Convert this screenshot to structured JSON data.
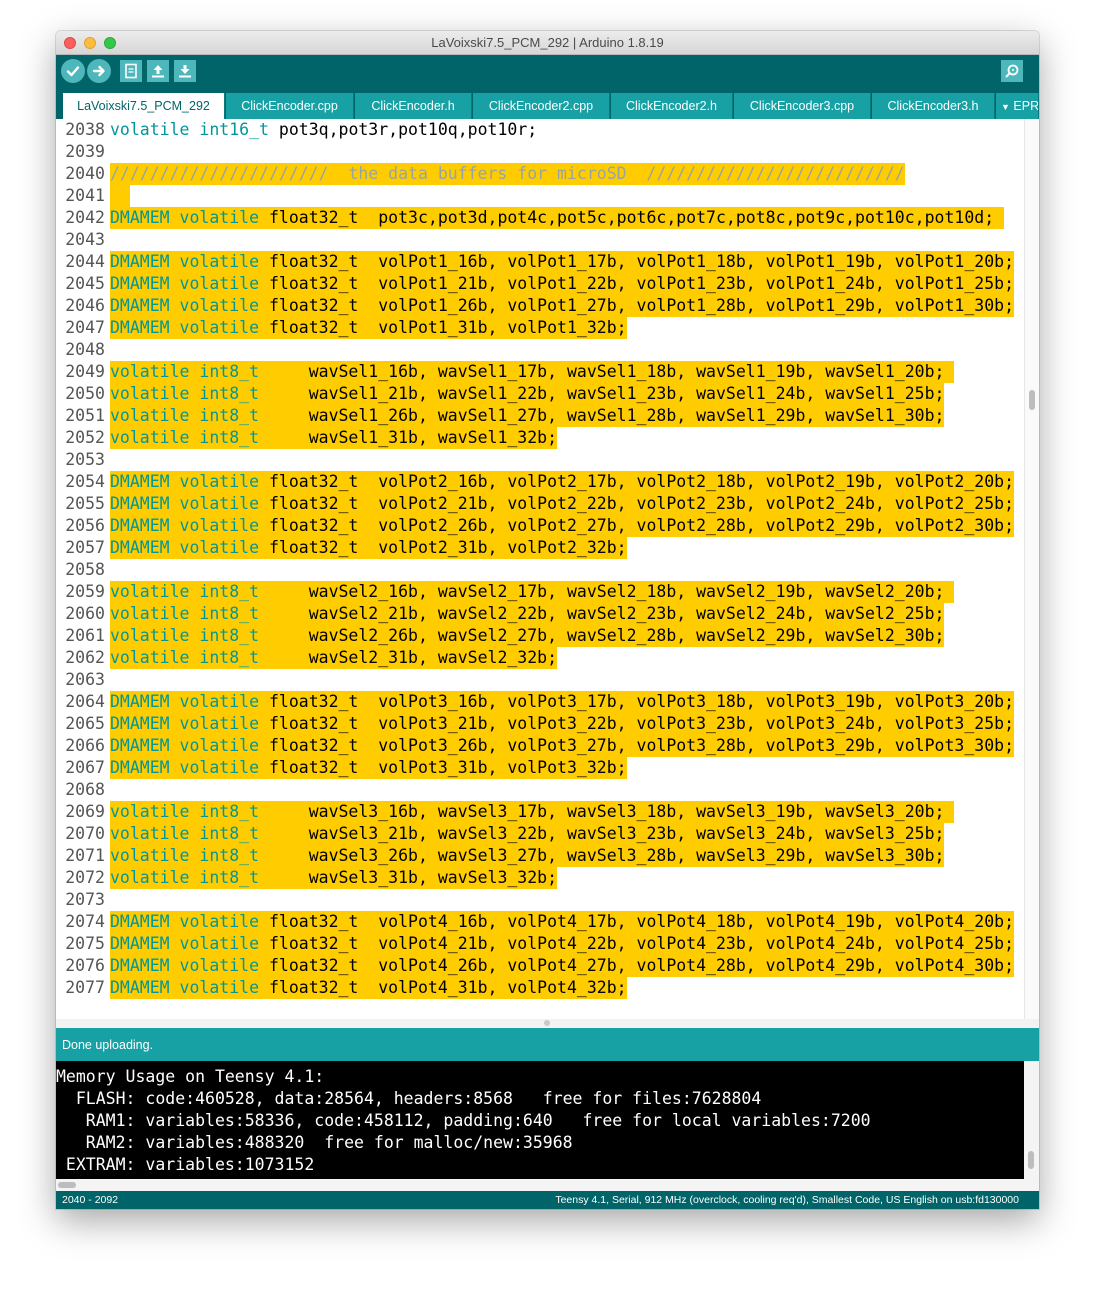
{
  "window": {
    "title": "LaVoixski7.5_PCM_292 | Arduino 1.8.19"
  },
  "toolbar": {
    "buttons": [
      {
        "name": "verify",
        "icon": "check-icon"
      },
      {
        "name": "upload",
        "icon": "arrow-right-icon"
      },
      {
        "name": "new",
        "icon": "new-file-icon"
      },
      {
        "name": "open",
        "icon": "open-arrow-up-icon"
      },
      {
        "name": "save",
        "icon": "save-arrow-down-icon"
      }
    ],
    "serial_monitor_icon": "magnifier-icon"
  },
  "tabs": [
    {
      "label": "LaVoixski7.5_PCM_292",
      "active": true
    },
    {
      "label": "ClickEncoder.cpp"
    },
    {
      "label": "ClickEncoder.h"
    },
    {
      "label": "ClickEncoder2.cpp"
    },
    {
      "label": "ClickEncoder2.h"
    },
    {
      "label": "ClickEncoder3.cpp"
    },
    {
      "label": "ClickEncoder3.h"
    },
    {
      "label": "EPR"
    }
  ],
  "colors": {
    "teal_dark": "#006468",
    "teal": "#17a1a5",
    "highlight": "#ffcc00",
    "keyword": "#00979c"
  },
  "editor": {
    "lines": [
      {
        "n": "2038",
        "hl": false,
        "parts": [
          [
            "kw",
            "volatile"
          ],
          [
            "pl",
            " "
          ],
          [
            "kw",
            "int16_t"
          ],
          [
            "pl",
            " pot3q,pot3r,pot10q,pot10r;"
          ]
        ]
      },
      {
        "n": "2039",
        "hl": false,
        "parts": []
      },
      {
        "n": "2040",
        "hl": true,
        "parts": [
          [
            "cm",
            "//////////////////////  the data buffers for microSD  //////////////////////////"
          ]
        ]
      },
      {
        "n": "2041",
        "hl": true,
        "parts": [
          [
            "pl",
            "  "
          ]
        ]
      },
      {
        "n": "2042",
        "hl": true,
        "parts": [
          [
            "kw",
            "DMAMEM"
          ],
          [
            "pl",
            " "
          ],
          [
            "kw",
            "volatile"
          ],
          [
            "pl",
            " float32_t  pot3c,pot3d,pot4c,pot5c,pot6c,pot7c,pot8c,pot9c,pot10c,pot10d; "
          ]
        ]
      },
      {
        "n": "2043",
        "hl": false,
        "parts": []
      },
      {
        "n": "2044",
        "hl": true,
        "parts": [
          [
            "kw",
            "DMAMEM"
          ],
          [
            "pl",
            " "
          ],
          [
            "kw",
            "volatile"
          ],
          [
            "pl",
            " float32_t  volPot1_16b, volPot1_17b, volPot1_18b, volPot1_19b, volPot1_20b;"
          ]
        ]
      },
      {
        "n": "2045",
        "hl": true,
        "parts": [
          [
            "kw",
            "DMAMEM"
          ],
          [
            "pl",
            " "
          ],
          [
            "kw",
            "volatile"
          ],
          [
            "pl",
            " float32_t  volPot1_21b, volPot1_22b, volPot1_23b, volPot1_24b, volPot1_25b;"
          ]
        ]
      },
      {
        "n": "2046",
        "hl": true,
        "parts": [
          [
            "kw",
            "DMAMEM"
          ],
          [
            "pl",
            " "
          ],
          [
            "kw",
            "volatile"
          ],
          [
            "pl",
            " float32_t  volPot1_26b, volPot1_27b, volPot1_28b, volPot1_29b, volPot1_30b;"
          ]
        ]
      },
      {
        "n": "2047",
        "hl": true,
        "parts": [
          [
            "kw",
            "DMAMEM"
          ],
          [
            "pl",
            " "
          ],
          [
            "kw",
            "volatile"
          ],
          [
            "pl",
            " float32_t  volPot1_31b, volPot1_32b;"
          ]
        ]
      },
      {
        "n": "2048",
        "hl": false,
        "parts": []
      },
      {
        "n": "2049",
        "hl": true,
        "parts": [
          [
            "kw",
            "volatile"
          ],
          [
            "pl",
            " "
          ],
          [
            "kw",
            "int8_t"
          ],
          [
            "pl",
            "     wavSel1_16b, wavSel1_17b, wavSel1_18b, wavSel1_19b, wavSel1_20b; "
          ]
        ]
      },
      {
        "n": "2050",
        "hl": true,
        "parts": [
          [
            "kw",
            "volatile"
          ],
          [
            "pl",
            " "
          ],
          [
            "kw",
            "int8_t"
          ],
          [
            "pl",
            "     wavSel1_21b, wavSel1_22b, wavSel1_23b, wavSel1_24b, wavSel1_25b;"
          ]
        ]
      },
      {
        "n": "2051",
        "hl": true,
        "parts": [
          [
            "kw",
            "volatile"
          ],
          [
            "pl",
            " "
          ],
          [
            "kw",
            "int8_t"
          ],
          [
            "pl",
            "     wavSel1_26b, wavSel1_27b, wavSel1_28b, wavSel1_29b, wavSel1_30b;"
          ]
        ]
      },
      {
        "n": "2052",
        "hl": true,
        "parts": [
          [
            "kw",
            "volatile"
          ],
          [
            "pl",
            " "
          ],
          [
            "kw",
            "int8_t"
          ],
          [
            "pl",
            "     wavSel1_31b, wavSel1_32b;"
          ]
        ]
      },
      {
        "n": "2053",
        "hl": false,
        "parts": []
      },
      {
        "n": "2054",
        "hl": true,
        "parts": [
          [
            "kw",
            "DMAMEM"
          ],
          [
            "pl",
            " "
          ],
          [
            "kw",
            "volatile"
          ],
          [
            "pl",
            " float32_t  volPot2_16b, volPot2_17b, volPot2_18b, volPot2_19b, volPot2_20b;"
          ]
        ]
      },
      {
        "n": "2055",
        "hl": true,
        "parts": [
          [
            "kw",
            "DMAMEM"
          ],
          [
            "pl",
            " "
          ],
          [
            "kw",
            "volatile"
          ],
          [
            "pl",
            " float32_t  volPot2_21b, volPot2_22b, volPot2_23b, volPot2_24b, volPot2_25b;"
          ]
        ]
      },
      {
        "n": "2056",
        "hl": true,
        "parts": [
          [
            "kw",
            "DMAMEM"
          ],
          [
            "pl",
            " "
          ],
          [
            "kw",
            "volatile"
          ],
          [
            "pl",
            " float32_t  volPot2_26b, volPot2_27b, volPot2_28b, volPot2_29b, volPot2_30b;"
          ]
        ]
      },
      {
        "n": "2057",
        "hl": true,
        "parts": [
          [
            "kw",
            "DMAMEM"
          ],
          [
            "pl",
            " "
          ],
          [
            "kw",
            "volatile"
          ],
          [
            "pl",
            " float32_t  volPot2_31b, volPot2_32b;"
          ]
        ]
      },
      {
        "n": "2058",
        "hl": false,
        "parts": []
      },
      {
        "n": "2059",
        "hl": true,
        "parts": [
          [
            "kw",
            "volatile"
          ],
          [
            "pl",
            " "
          ],
          [
            "kw",
            "int8_t"
          ],
          [
            "pl",
            "     wavSel2_16b, wavSel2_17b, wavSel2_18b, wavSel2_19b, wavSel2_20b; "
          ]
        ]
      },
      {
        "n": "2060",
        "hl": true,
        "parts": [
          [
            "kw",
            "volatile"
          ],
          [
            "pl",
            " "
          ],
          [
            "kw",
            "int8_t"
          ],
          [
            "pl",
            "     wavSel2_21b, wavSel2_22b, wavSel2_23b, wavSel2_24b, wavSel2_25b;"
          ]
        ]
      },
      {
        "n": "2061",
        "hl": true,
        "parts": [
          [
            "kw",
            "volatile"
          ],
          [
            "pl",
            " "
          ],
          [
            "kw",
            "int8_t"
          ],
          [
            "pl",
            "     wavSel2_26b, wavSel2_27b, wavSel2_28b, wavSel2_29b, wavSel2_30b;"
          ]
        ]
      },
      {
        "n": "2062",
        "hl": true,
        "parts": [
          [
            "kw",
            "volatile"
          ],
          [
            "pl",
            " "
          ],
          [
            "kw",
            "int8_t"
          ],
          [
            "pl",
            "     wavSel2_31b, wavSel2_32b;"
          ]
        ]
      },
      {
        "n": "2063",
        "hl": false,
        "parts": []
      },
      {
        "n": "2064",
        "hl": true,
        "parts": [
          [
            "kw",
            "DMAMEM"
          ],
          [
            "pl",
            " "
          ],
          [
            "kw",
            "volatile"
          ],
          [
            "pl",
            " float32_t  volPot3_16b, volPot3_17b, volPot3_18b, volPot3_19b, volPot3_20b;"
          ]
        ]
      },
      {
        "n": "2065",
        "hl": true,
        "parts": [
          [
            "kw",
            "DMAMEM"
          ],
          [
            "pl",
            " "
          ],
          [
            "kw",
            "volatile"
          ],
          [
            "pl",
            " float32_t  volPot3_21b, volPot3_22b, volPot3_23b, volPot3_24b, volPot3_25b;"
          ]
        ]
      },
      {
        "n": "2066",
        "hl": true,
        "parts": [
          [
            "kw",
            "DMAMEM"
          ],
          [
            "pl",
            " "
          ],
          [
            "kw",
            "volatile"
          ],
          [
            "pl",
            " float32_t  volPot3_26b, volPot3_27b, volPot3_28b, volPot3_29b, volPot3_30b;"
          ]
        ]
      },
      {
        "n": "2067",
        "hl": true,
        "parts": [
          [
            "kw",
            "DMAMEM"
          ],
          [
            "pl",
            " "
          ],
          [
            "kw",
            "volatile"
          ],
          [
            "pl",
            " float32_t  volPot3_31b, volPot3_32b;"
          ]
        ]
      },
      {
        "n": "2068",
        "hl": false,
        "parts": []
      },
      {
        "n": "2069",
        "hl": true,
        "parts": [
          [
            "kw",
            "volatile"
          ],
          [
            "pl",
            " "
          ],
          [
            "kw",
            "int8_t"
          ],
          [
            "pl",
            "     wavSel3_16b, wavSel3_17b, wavSel3_18b, wavSel3_19b, wavSel3_20b; "
          ]
        ]
      },
      {
        "n": "2070",
        "hl": true,
        "parts": [
          [
            "kw",
            "volatile"
          ],
          [
            "pl",
            " "
          ],
          [
            "kw",
            "int8_t"
          ],
          [
            "pl",
            "     wavSel3_21b, wavSel3_22b, wavSel3_23b, wavSel3_24b, wavSel3_25b;"
          ]
        ]
      },
      {
        "n": "2071",
        "hl": true,
        "parts": [
          [
            "kw",
            "volatile"
          ],
          [
            "pl",
            " "
          ],
          [
            "kw",
            "int8_t"
          ],
          [
            "pl",
            "     wavSel3_26b, wavSel3_27b, wavSel3_28b, wavSel3_29b, wavSel3_30b;"
          ]
        ]
      },
      {
        "n": "2072",
        "hl": true,
        "parts": [
          [
            "kw",
            "volatile"
          ],
          [
            "pl",
            " "
          ],
          [
            "kw",
            "int8_t"
          ],
          [
            "pl",
            "     wavSel3_31b, wavSel3_32b;"
          ]
        ]
      },
      {
        "n": "2073",
        "hl": false,
        "parts": []
      },
      {
        "n": "2074",
        "hl": true,
        "parts": [
          [
            "kw",
            "DMAMEM"
          ],
          [
            "pl",
            " "
          ],
          [
            "kw",
            "volatile"
          ],
          [
            "pl",
            " float32_t  volPot4_16b, volPot4_17b, volPot4_18b, volPot4_19b, volPot4_20b;"
          ]
        ]
      },
      {
        "n": "2075",
        "hl": true,
        "parts": [
          [
            "kw",
            "DMAMEM"
          ],
          [
            "pl",
            " "
          ],
          [
            "kw",
            "volatile"
          ],
          [
            "pl",
            " float32_t  volPot4_21b, volPot4_22b, volPot4_23b, volPot4_24b, volPot4_25b;"
          ]
        ]
      },
      {
        "n": "2076",
        "hl": true,
        "parts": [
          [
            "kw",
            "DMAMEM"
          ],
          [
            "pl",
            " "
          ],
          [
            "kw",
            "volatile"
          ],
          [
            "pl",
            " float32_t  volPot4_26b, volPot4_27b, volPot4_28b, volPot4_29b, volPot4_30b;"
          ]
        ]
      },
      {
        "n": "2077",
        "hl": true,
        "parts": [
          [
            "kw",
            "DMAMEM"
          ],
          [
            "pl",
            " "
          ],
          [
            "kw",
            "volatile"
          ],
          [
            "pl",
            " float32_t  volPot4_31b, volPot4_32b;"
          ]
        ]
      }
    ]
  },
  "status": {
    "message": "Done uploading."
  },
  "console": {
    "lines": [
      "Memory Usage on Teensy 4.1:",
      "  FLASH: code:460528, data:28564, headers:8568   free for files:7628804",
      "   RAM1: variables:58336, code:458112, padding:640   free for local variables:7200",
      "   RAM2: variables:488320  free for malloc/new:35968",
      " EXTRAM: variables:1073152"
    ]
  },
  "bottombar": {
    "line_range": "2040 - 2092",
    "board_info": "Teensy 4.1, Serial, 912 MHz (overclock, cooling req'd), Smallest Code, US English on usb:fd130000"
  }
}
